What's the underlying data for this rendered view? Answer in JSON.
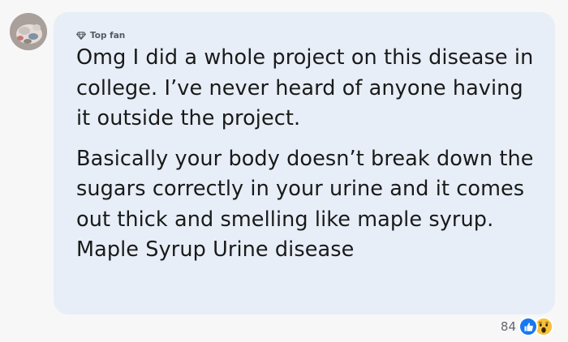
{
  "comment": {
    "badge_label": "Top fan",
    "badge_icon": "diamond-icon",
    "paragraphs": [
      "Omg I did a whole project on this disease in college. I’ve never heard of anyone having it outside the project.",
      "Basically your body doesn’t break down the sugars correctly in your urine and it comes out thick and smelling like maple syrup. Maple Syrup Urine disease"
    ],
    "reaction_count": "84",
    "reactions": [
      "like-icon",
      "wow-icon"
    ]
  },
  "colors": {
    "background": "#f7f7f8",
    "bubble": "#e7eef7",
    "text": "#1a1a1a",
    "muted": "#65676b",
    "like": "#1877f2",
    "wow": "#f7c13b"
  }
}
